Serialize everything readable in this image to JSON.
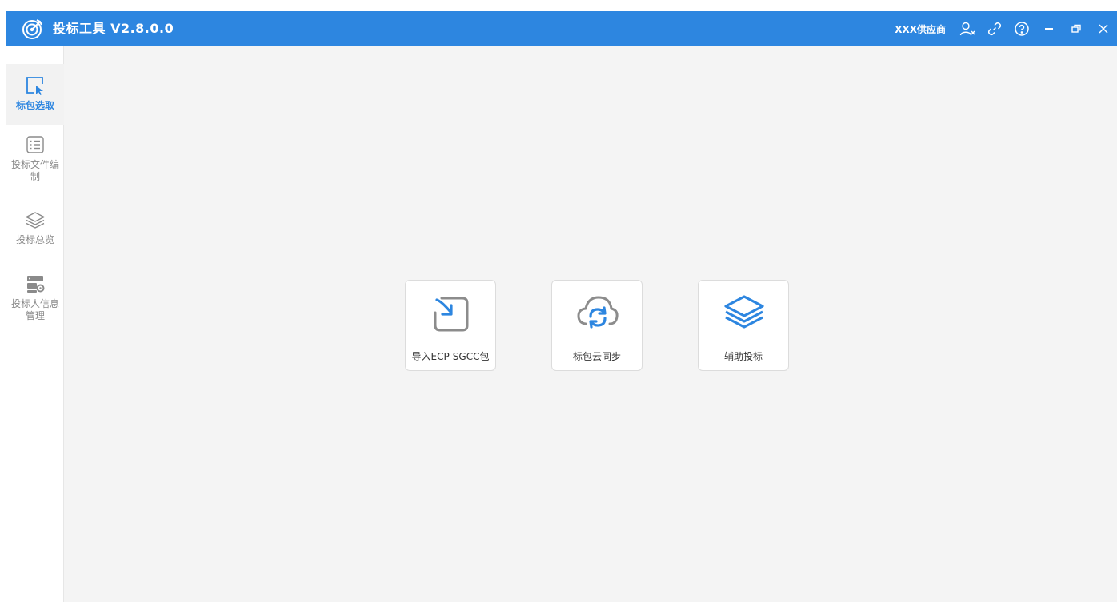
{
  "app": {
    "title": "投标工具 V2.8.0.0",
    "vendor": "XXX供应商"
  },
  "colors": {
    "titlebar": "#2d86e0",
    "accent": "#2d86e0",
    "icon_gray": "#8a8a8a",
    "background": "#f4f4f4"
  },
  "titlebar_icons": [
    "user-x-icon",
    "link-icon",
    "help-icon",
    "minimize-icon",
    "restore-icon",
    "close-icon"
  ],
  "sidebar": {
    "items": [
      {
        "label": "标包选取",
        "icon": "cursor-select-icon",
        "active": true
      },
      {
        "label": "投标文件编制",
        "icon": "list-icon",
        "active": false
      },
      {
        "label": "投标总览",
        "icon": "layers-icon",
        "active": false
      },
      {
        "label": "投标人信息管理",
        "icon": "server-settings-icon",
        "active": false
      }
    ]
  },
  "tiles": [
    {
      "label": "导入ECP-SGCC包",
      "icon": "import-icon"
    },
    {
      "label": "标包云同步",
      "icon": "cloud-sync-icon"
    },
    {
      "label": "辅助投标",
      "icon": "stack-layers-icon"
    }
  ]
}
